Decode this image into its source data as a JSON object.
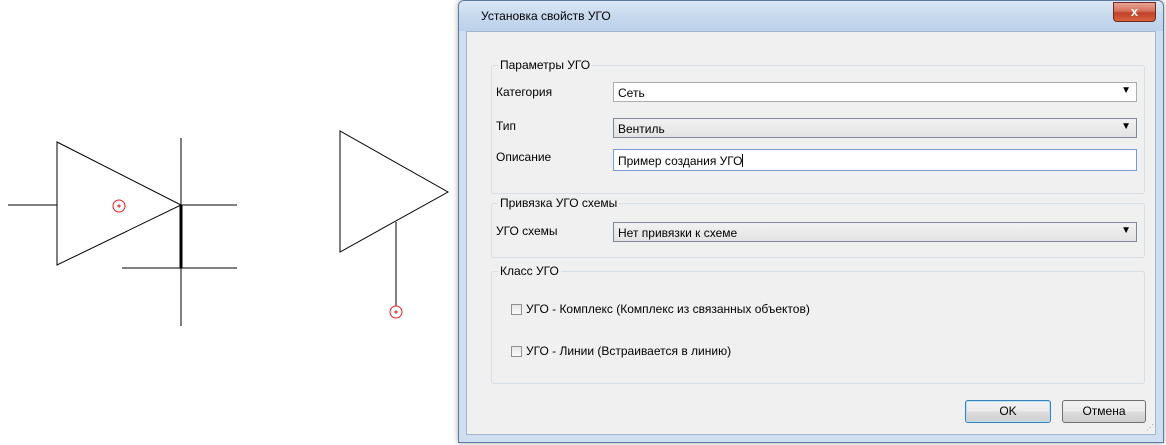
{
  "dialog": {
    "title": "Установка свойств УГО",
    "close_label": "x",
    "group_params": {
      "legend": "Параметры УГО",
      "category_label": "Категория",
      "category_value": "Сеть",
      "type_label": "Тип",
      "type_value": "Вентиль",
      "description_label": "Описание",
      "description_value": "Пример создания УГО"
    },
    "group_binding": {
      "legend": "Привязка УГО схемы",
      "scheme_label": "УГО схемы",
      "scheme_value": "Нет привязки к схеме"
    },
    "group_class": {
      "legend": "Класс УГО",
      "complex_label": "УГО - Комплекс (Комплекс из связанных объектов)",
      "complex_checked": false,
      "lines_label": "УГО - Линии (Встраивается в линию)",
      "lines_checked": false
    },
    "ok_label": "OK",
    "cancel_label": "Отмена"
  },
  "colors": {
    "marker": "#e02020",
    "stroke": "#000000"
  },
  "icons": {
    "dropdown": "▼",
    "close": "x"
  }
}
